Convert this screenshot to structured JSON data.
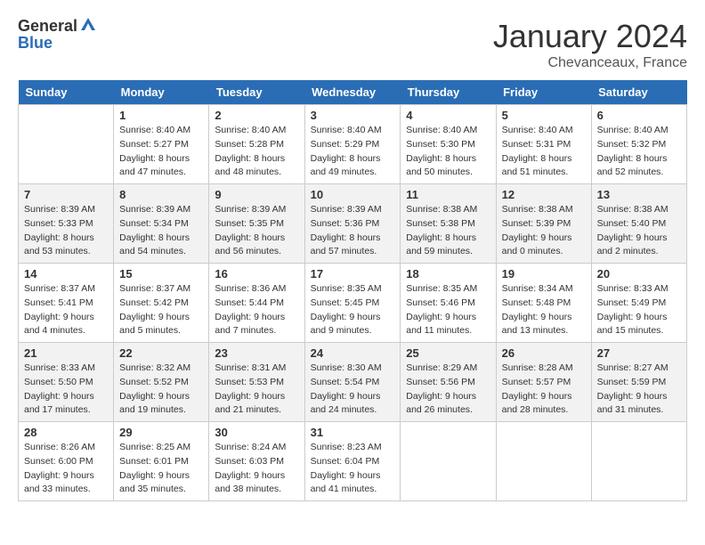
{
  "header": {
    "logo_general": "General",
    "logo_blue": "Blue",
    "title": "January 2024",
    "subtitle": "Chevanceaux, France"
  },
  "columns": [
    "Sunday",
    "Monday",
    "Tuesday",
    "Wednesday",
    "Thursday",
    "Friday",
    "Saturday"
  ],
  "weeks": [
    [
      {
        "day": "",
        "empty": true
      },
      {
        "day": "1",
        "sunrise": "Sunrise: 8:40 AM",
        "sunset": "Sunset: 5:27 PM",
        "daylight": "Daylight: 8 hours and 47 minutes."
      },
      {
        "day": "2",
        "sunrise": "Sunrise: 8:40 AM",
        "sunset": "Sunset: 5:28 PM",
        "daylight": "Daylight: 8 hours and 48 minutes."
      },
      {
        "day": "3",
        "sunrise": "Sunrise: 8:40 AM",
        "sunset": "Sunset: 5:29 PM",
        "daylight": "Daylight: 8 hours and 49 minutes."
      },
      {
        "day": "4",
        "sunrise": "Sunrise: 8:40 AM",
        "sunset": "Sunset: 5:30 PM",
        "daylight": "Daylight: 8 hours and 50 minutes."
      },
      {
        "day": "5",
        "sunrise": "Sunrise: 8:40 AM",
        "sunset": "Sunset: 5:31 PM",
        "daylight": "Daylight: 8 hours and 51 minutes."
      },
      {
        "day": "6",
        "sunrise": "Sunrise: 8:40 AM",
        "sunset": "Sunset: 5:32 PM",
        "daylight": "Daylight: 8 hours and 52 minutes."
      }
    ],
    [
      {
        "day": "7",
        "sunrise": "Sunrise: 8:39 AM",
        "sunset": "Sunset: 5:33 PM",
        "daylight": "Daylight: 8 hours and 53 minutes."
      },
      {
        "day": "8",
        "sunrise": "Sunrise: 8:39 AM",
        "sunset": "Sunset: 5:34 PM",
        "daylight": "Daylight: 8 hours and 54 minutes."
      },
      {
        "day": "9",
        "sunrise": "Sunrise: 8:39 AM",
        "sunset": "Sunset: 5:35 PM",
        "daylight": "Daylight: 8 hours and 56 minutes."
      },
      {
        "day": "10",
        "sunrise": "Sunrise: 8:39 AM",
        "sunset": "Sunset: 5:36 PM",
        "daylight": "Daylight: 8 hours and 57 minutes."
      },
      {
        "day": "11",
        "sunrise": "Sunrise: 8:38 AM",
        "sunset": "Sunset: 5:38 PM",
        "daylight": "Daylight: 8 hours and 59 minutes."
      },
      {
        "day": "12",
        "sunrise": "Sunrise: 8:38 AM",
        "sunset": "Sunset: 5:39 PM",
        "daylight": "Daylight: 9 hours and 0 minutes."
      },
      {
        "day": "13",
        "sunrise": "Sunrise: 8:38 AM",
        "sunset": "Sunset: 5:40 PM",
        "daylight": "Daylight: 9 hours and 2 minutes."
      }
    ],
    [
      {
        "day": "14",
        "sunrise": "Sunrise: 8:37 AM",
        "sunset": "Sunset: 5:41 PM",
        "daylight": "Daylight: 9 hours and 4 minutes."
      },
      {
        "day": "15",
        "sunrise": "Sunrise: 8:37 AM",
        "sunset": "Sunset: 5:42 PM",
        "daylight": "Daylight: 9 hours and 5 minutes."
      },
      {
        "day": "16",
        "sunrise": "Sunrise: 8:36 AM",
        "sunset": "Sunset: 5:44 PM",
        "daylight": "Daylight: 9 hours and 7 minutes."
      },
      {
        "day": "17",
        "sunrise": "Sunrise: 8:35 AM",
        "sunset": "Sunset: 5:45 PM",
        "daylight": "Daylight: 9 hours and 9 minutes."
      },
      {
        "day": "18",
        "sunrise": "Sunrise: 8:35 AM",
        "sunset": "Sunset: 5:46 PM",
        "daylight": "Daylight: 9 hours and 11 minutes."
      },
      {
        "day": "19",
        "sunrise": "Sunrise: 8:34 AM",
        "sunset": "Sunset: 5:48 PM",
        "daylight": "Daylight: 9 hours and 13 minutes."
      },
      {
        "day": "20",
        "sunrise": "Sunrise: 8:33 AM",
        "sunset": "Sunset: 5:49 PM",
        "daylight": "Daylight: 9 hours and 15 minutes."
      }
    ],
    [
      {
        "day": "21",
        "sunrise": "Sunrise: 8:33 AM",
        "sunset": "Sunset: 5:50 PM",
        "daylight": "Daylight: 9 hours and 17 minutes."
      },
      {
        "day": "22",
        "sunrise": "Sunrise: 8:32 AM",
        "sunset": "Sunset: 5:52 PM",
        "daylight": "Daylight: 9 hours and 19 minutes."
      },
      {
        "day": "23",
        "sunrise": "Sunrise: 8:31 AM",
        "sunset": "Sunset: 5:53 PM",
        "daylight": "Daylight: 9 hours and 21 minutes."
      },
      {
        "day": "24",
        "sunrise": "Sunrise: 8:30 AM",
        "sunset": "Sunset: 5:54 PM",
        "daylight": "Daylight: 9 hours and 24 minutes."
      },
      {
        "day": "25",
        "sunrise": "Sunrise: 8:29 AM",
        "sunset": "Sunset: 5:56 PM",
        "daylight": "Daylight: 9 hours and 26 minutes."
      },
      {
        "day": "26",
        "sunrise": "Sunrise: 8:28 AM",
        "sunset": "Sunset: 5:57 PM",
        "daylight": "Daylight: 9 hours and 28 minutes."
      },
      {
        "day": "27",
        "sunrise": "Sunrise: 8:27 AM",
        "sunset": "Sunset: 5:59 PM",
        "daylight": "Daylight: 9 hours and 31 minutes."
      }
    ],
    [
      {
        "day": "28",
        "sunrise": "Sunrise: 8:26 AM",
        "sunset": "Sunset: 6:00 PM",
        "daylight": "Daylight: 9 hours and 33 minutes."
      },
      {
        "day": "29",
        "sunrise": "Sunrise: 8:25 AM",
        "sunset": "Sunset: 6:01 PM",
        "daylight": "Daylight: 9 hours and 35 minutes."
      },
      {
        "day": "30",
        "sunrise": "Sunrise: 8:24 AM",
        "sunset": "Sunset: 6:03 PM",
        "daylight": "Daylight: 9 hours and 38 minutes."
      },
      {
        "day": "31",
        "sunrise": "Sunrise: 8:23 AM",
        "sunset": "Sunset: 6:04 PM",
        "daylight": "Daylight: 9 hours and 41 minutes."
      },
      {
        "day": "",
        "empty": true
      },
      {
        "day": "",
        "empty": true
      },
      {
        "day": "",
        "empty": true
      }
    ]
  ]
}
